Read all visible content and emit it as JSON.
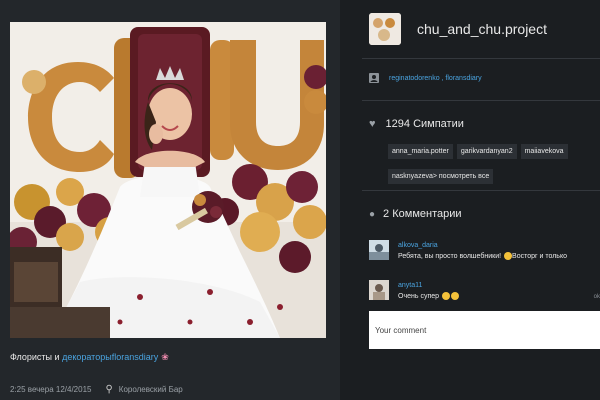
{
  "post": {
    "caption_prefix": "Флористы и ",
    "caption_tag": "декораторы",
    "caption_mention": "floransdiary",
    "timestamp": "2:25 вечера 12/4/2015",
    "location": "Королевский Бар"
  },
  "profile": {
    "username": "chu_and_chu.project",
    "avatar_text": "CHU"
  },
  "tagged": {
    "users": "reginatodorenko , floransdiary"
  },
  "likes": {
    "count": "1294",
    "label": "Симпатии",
    "users": [
      "anna_maria.potter",
      "garikvardanyan2",
      "maiiavekova"
    ],
    "more_user": "nasknyazeva",
    "more_label": "> посмотреть все"
  },
  "comments": {
    "count": "2",
    "label": "Комментарии",
    "items": [
      {
        "user": "alkova_daria",
        "text": "Ребята, вы просто волшебники!",
        "text2": "Восторг и только",
        "time": ""
      },
      {
        "user": "anyta11",
        "text": "Очень супер",
        "time": "ok"
      }
    ],
    "input_placeholder": "Your comment"
  },
  "colors": {
    "link": "#4aa3df",
    "bg": "#1b1e21",
    "panel": "#23272b"
  }
}
